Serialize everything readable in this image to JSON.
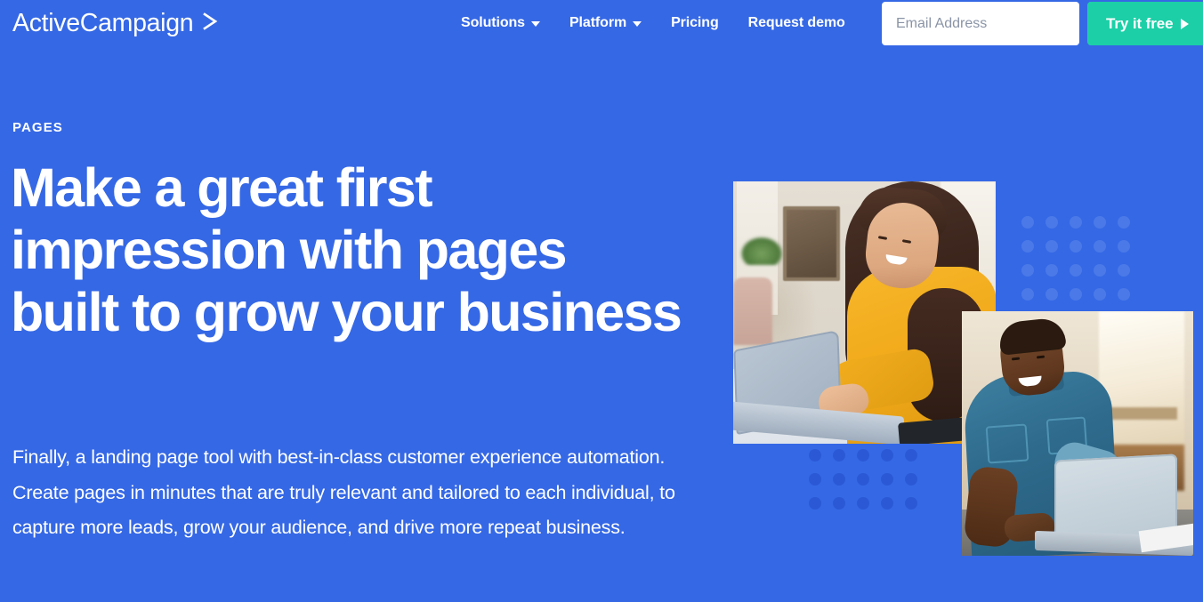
{
  "brand": {
    "name": "ActiveCampaign",
    "logo_icon": "chevron-right-icon",
    "accent_blue": "#3568E5",
    "accent_green": "#1CCFA7"
  },
  "header": {
    "nav": [
      {
        "label": "Solutions",
        "has_dropdown": true,
        "caret_icon": "chevron-down-icon"
      },
      {
        "label": "Platform",
        "has_dropdown": true,
        "caret_icon": "chevron-down-icon"
      },
      {
        "label": "Pricing",
        "has_dropdown": false
      },
      {
        "label": "Request demo",
        "has_dropdown": false
      }
    ],
    "email_input": {
      "placeholder": "Email Address",
      "value": ""
    },
    "cta": {
      "label": "Try it free",
      "icon": "play-triangle-icon"
    }
  },
  "hero": {
    "eyebrow": "PAGES",
    "headline": "Make a great first impression with pages built to grow your business",
    "subcopy": "Finally, a landing page tool with best-in-class customer experience automation. Create pages in minutes that are truly relevant and tailored to each individual, to capture more leads, grow your audience, and drive more repeat business."
  },
  "media": {
    "photo_1_alt": "Woman in yellow sweater smiling at a laptop",
    "photo_2_alt": "Man in denim shirt smiling at a laptop",
    "dots_top": {
      "columns": 5,
      "rows": 4,
      "color": "#4B79E8"
    },
    "dots_bottom": {
      "columns": 5,
      "rows": 3,
      "color": "#2B59D6"
    }
  }
}
